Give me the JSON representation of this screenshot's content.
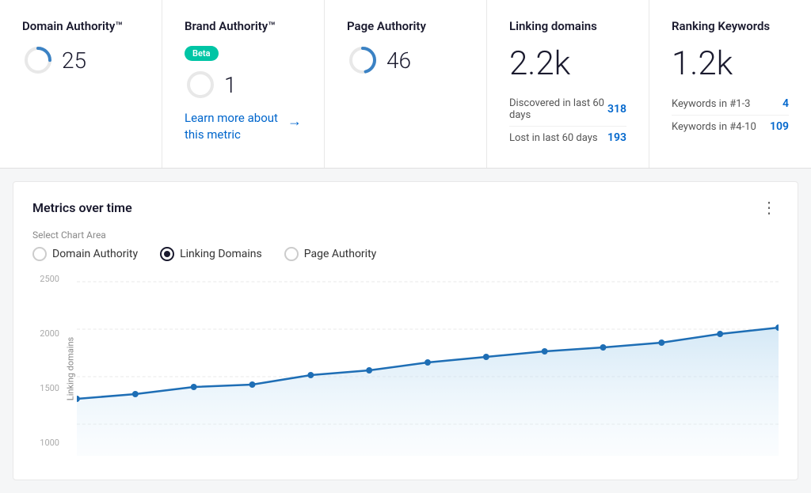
{
  "cards": {
    "domain_authority": {
      "title": "Domain Authority™",
      "value": "25",
      "donut_progress": 25
    },
    "brand_authority": {
      "title": "Brand Authority™",
      "badge": "Beta",
      "value": "1",
      "learn_more": "Learn more about this metric",
      "arrow": "→"
    },
    "page_authority": {
      "title": "Page Authority",
      "value": "46",
      "donut_progress": 46
    },
    "linking_domains": {
      "title": "Linking domains",
      "value": "2.2k",
      "rows": [
        {
          "label": "Discovered in last 60 days",
          "value": "318"
        },
        {
          "label": "Lost in last 60 days",
          "value": "193"
        }
      ]
    },
    "ranking_keywords": {
      "title": "Ranking Keywords",
      "value": "1.2k",
      "rows": [
        {
          "label": "Keywords in #1-3",
          "value": "4"
        },
        {
          "label": "Keywords in #4-10",
          "value": "109"
        }
      ]
    }
  },
  "chart_section": {
    "title": "Metrics over time",
    "select_label": "Select Chart Area",
    "radio_options": [
      {
        "label": "Domain Authority",
        "selected": false
      },
      {
        "label": "Linking Domains",
        "selected": true
      },
      {
        "label": "Page Authority",
        "selected": false
      }
    ],
    "y_axis_label": "Linking domains",
    "y_axis_ticks": [
      "2500",
      "2000",
      "1500",
      "1000"
    ],
    "dots_icon": "⋮"
  }
}
